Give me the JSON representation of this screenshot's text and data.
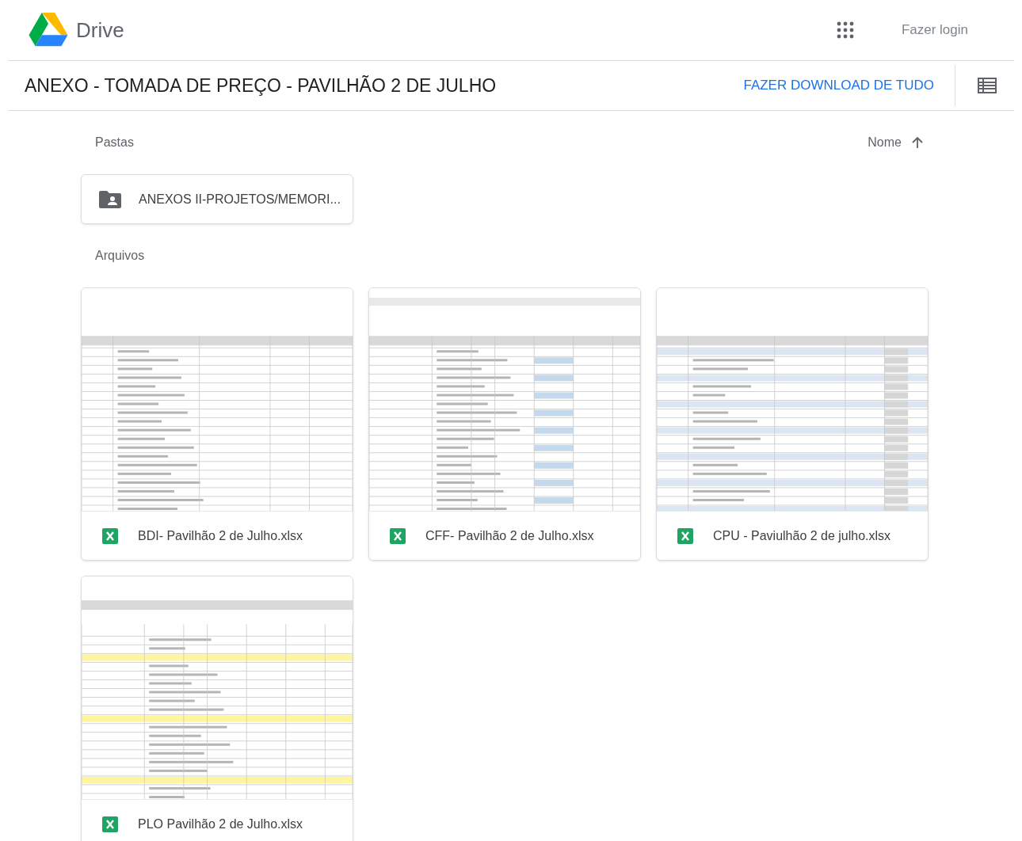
{
  "header": {
    "product": "Drive",
    "login": "Fazer login"
  },
  "titlebar": {
    "title": "ANEXO - TOMADA DE PREÇO - PAVILHÃO 2 DE JULHO",
    "download": "FAZER DOWNLOAD DE TUDO"
  },
  "folders_section": {
    "label": "Pastas",
    "sort": "Nome"
  },
  "folders": [
    {
      "name": "ANEXOS II-PROJETOS/MEMORI..."
    }
  ],
  "files_section": {
    "label": "Arquivos"
  },
  "files": [
    {
      "name": "BDI- Pavilhão 2 de Julho.xlsx"
    },
    {
      "name": "CFF- Pavilhão 2 de Julho.xlsx"
    },
    {
      "name": "CPU - Paviulhão 2 de julho.xlsx"
    },
    {
      "name": "PLO Pavilhão 2 de Julho.xlsx"
    }
  ]
}
